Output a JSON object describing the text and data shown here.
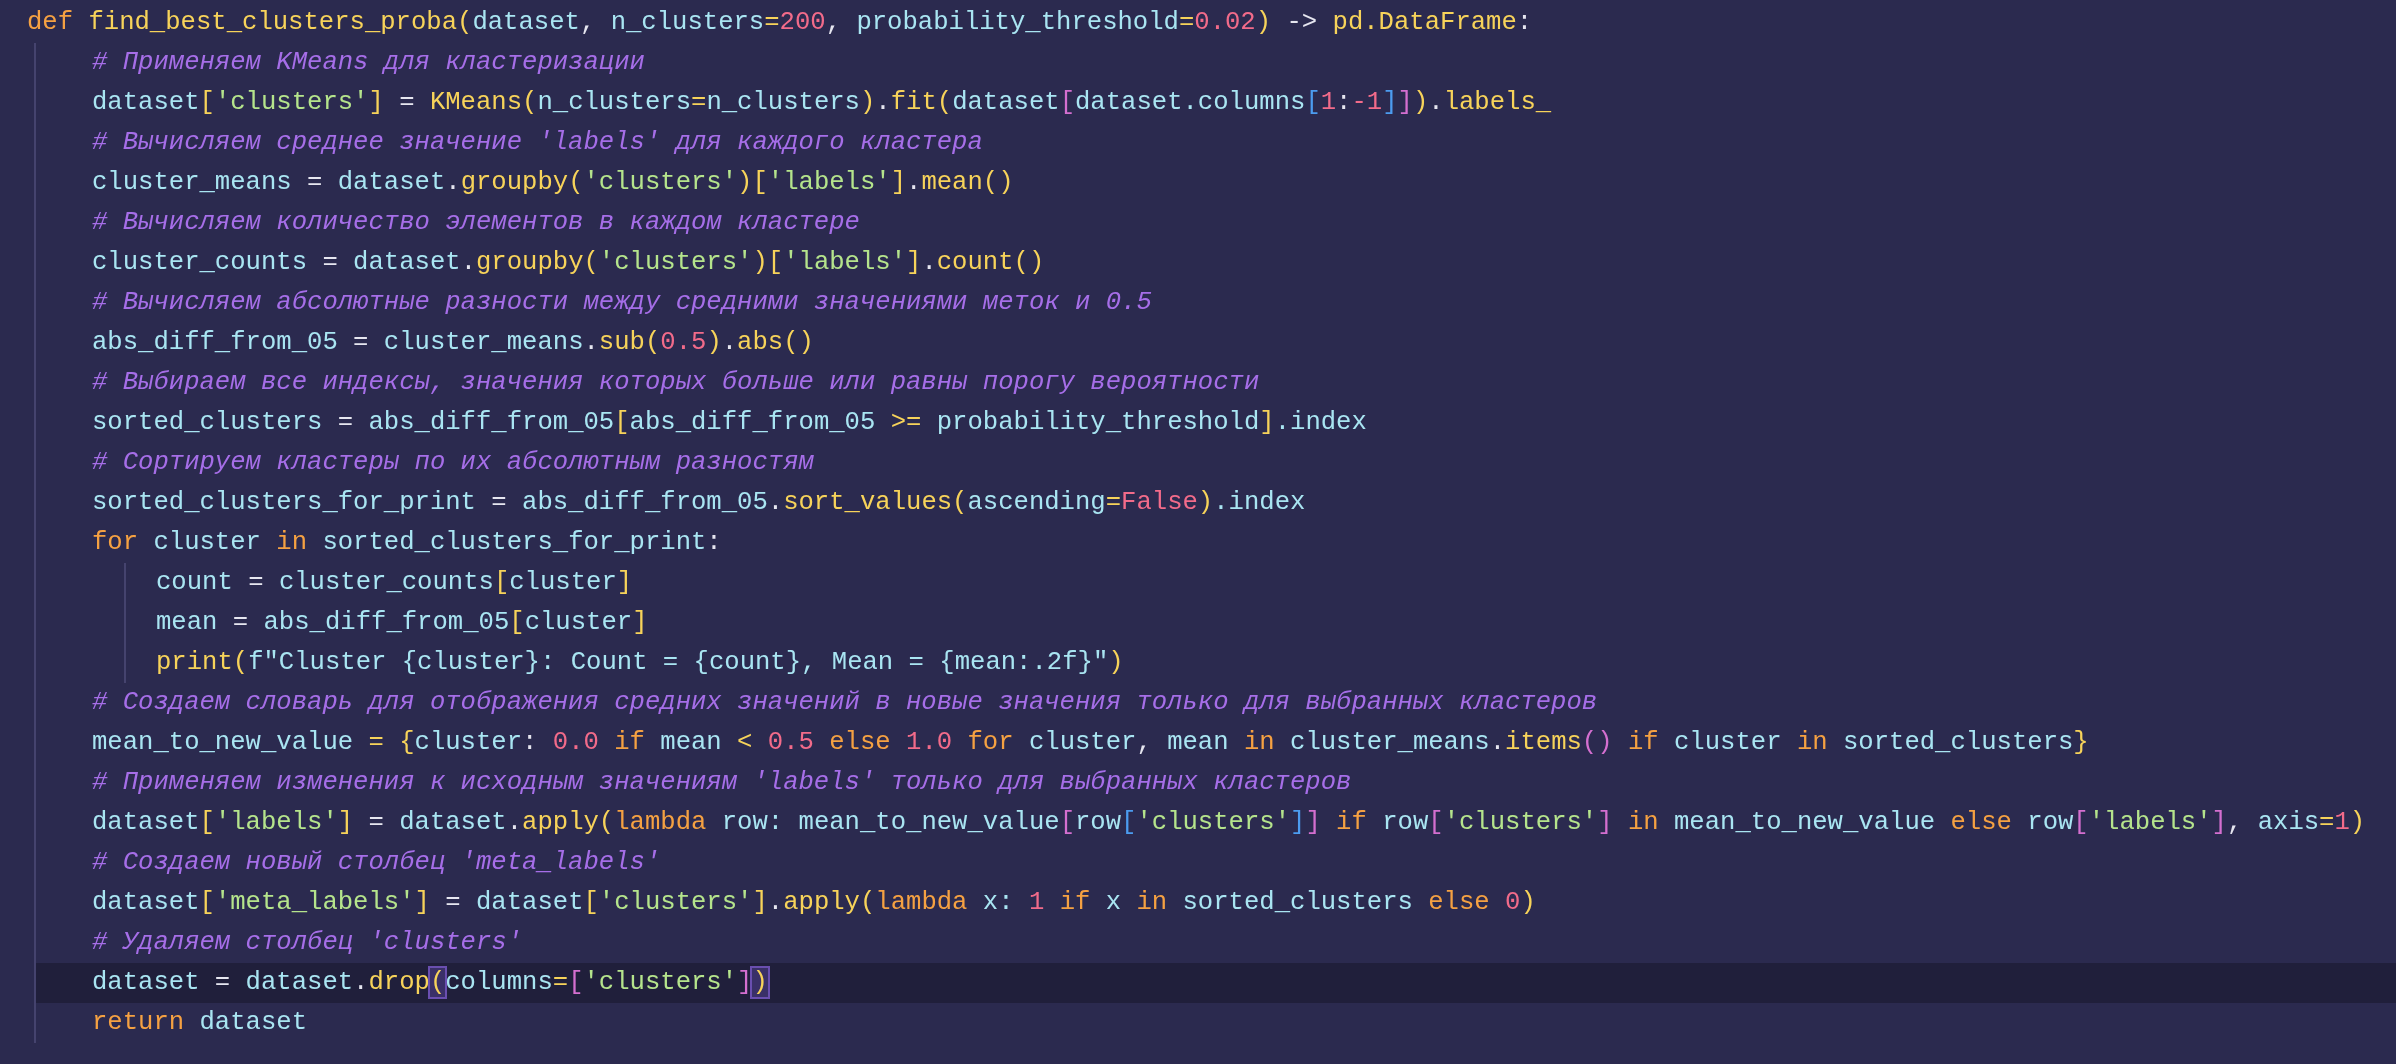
{
  "editor": {
    "lines": [
      {
        "current": false,
        "tokens": [
          {
            "text": "def",
            "kind": "keyword"
          },
          {
            "text": " find_best_clusters_proba",
            "kind": "call"
          },
          {
            "text": "(",
            "kind": "bracket1"
          },
          {
            "text": "dataset",
            "kind": "name"
          },
          {
            "text": ", ",
            "kind": "plain"
          },
          {
            "text": "n_clusters",
            "kind": "name"
          },
          {
            "text": "=",
            "kind": "operator"
          },
          {
            "text": "200",
            "kind": "number"
          },
          {
            "text": ", ",
            "kind": "plain"
          },
          {
            "text": "probability_threshold",
            "kind": "name"
          },
          {
            "text": "=",
            "kind": "operator"
          },
          {
            "text": "0.02",
            "kind": "number"
          },
          {
            "text": ")",
            "kind": "bracket1"
          },
          {
            "text": " -> ",
            "kind": "plain"
          },
          {
            "text": "pd.DataFrame",
            "kind": "call"
          },
          {
            "text": ":",
            "kind": "plain"
          }
        ],
        "children": [
          {
            "current": false,
            "tokens": [
              {
                "text": "# Применяем KMeans для кластеризации",
                "kind": "comment"
              }
            ]
          },
          {
            "current": false,
            "tokens": [
              {
                "text": "dataset",
                "kind": "name"
              },
              {
                "text": "[",
                "kind": "bracket1"
              },
              {
                "text": "'clusters'",
                "kind": "string"
              },
              {
                "text": "]",
                "kind": "bracket1"
              },
              {
                "text": " = ",
                "kind": "plain"
              },
              {
                "text": "KMeans",
                "kind": "call"
              },
              {
                "text": "(",
                "kind": "bracket1"
              },
              {
                "text": "n_clusters",
                "kind": "name"
              },
              {
                "text": "=",
                "kind": "operator"
              },
              {
                "text": "n_clusters",
                "kind": "name"
              },
              {
                "text": ")",
                "kind": "bracket1"
              },
              {
                "text": ".",
                "kind": "plain"
              },
              {
                "text": "fit",
                "kind": "call"
              },
              {
                "text": "(",
                "kind": "bracket1"
              },
              {
                "text": "dataset",
                "kind": "name"
              },
              {
                "text": "[",
                "kind": "bracket2"
              },
              {
                "text": "dataset.columns",
                "kind": "name"
              },
              {
                "text": "[",
                "kind": "bracket3"
              },
              {
                "text": "1",
                "kind": "number"
              },
              {
                "text": ":",
                "kind": "plain"
              },
              {
                "text": "-1",
                "kind": "number"
              },
              {
                "text": "]",
                "kind": "bracket3"
              },
              {
                "text": "]",
                "kind": "bracket2"
              },
              {
                "text": ")",
                "kind": "bracket1"
              },
              {
                "text": ".",
                "kind": "plain"
              },
              {
                "text": "labels_",
                "kind": "call"
              }
            ]
          },
          {
            "current": false,
            "tokens": [
              {
                "text": "# Вычисляем среднее значение 'labels' для каждого кластера",
                "kind": "comment"
              }
            ]
          },
          {
            "current": false,
            "tokens": [
              {
                "text": "cluster_means",
                "kind": "name"
              },
              {
                "text": " = ",
                "kind": "plain"
              },
              {
                "text": "dataset",
                "kind": "name"
              },
              {
                "text": ".",
                "kind": "plain"
              },
              {
                "text": "groupby",
                "kind": "call"
              },
              {
                "text": "(",
                "kind": "bracket1"
              },
              {
                "text": "'clusters'",
                "kind": "string"
              },
              {
                "text": ")",
                "kind": "bracket1"
              },
              {
                "text": "[",
                "kind": "bracket1"
              },
              {
                "text": "'labels'",
                "kind": "string"
              },
              {
                "text": "]",
                "kind": "bracket1"
              },
              {
                "text": ".",
                "kind": "plain"
              },
              {
                "text": "mean",
                "kind": "call"
              },
              {
                "text": "()",
                "kind": "bracket1"
              }
            ]
          },
          {
            "current": false,
            "tokens": [
              {
                "text": "# Вычисляем количество элементов в каждом кластере",
                "kind": "comment"
              }
            ]
          },
          {
            "current": false,
            "tokens": [
              {
                "text": "cluster_counts",
                "kind": "name"
              },
              {
                "text": " = ",
                "kind": "plain"
              },
              {
                "text": "dataset",
                "kind": "name"
              },
              {
                "text": ".",
                "kind": "plain"
              },
              {
                "text": "groupby",
                "kind": "call"
              },
              {
                "text": "(",
                "kind": "bracket1"
              },
              {
                "text": "'clusters'",
                "kind": "string"
              },
              {
                "text": ")",
                "kind": "bracket1"
              },
              {
                "text": "[",
                "kind": "bracket1"
              },
              {
                "text": "'labels'",
                "kind": "string"
              },
              {
                "text": "]",
                "kind": "bracket1"
              },
              {
                "text": ".",
                "kind": "plain"
              },
              {
                "text": "count",
                "kind": "call"
              },
              {
                "text": "()",
                "kind": "bracket1"
              }
            ]
          },
          {
            "current": false,
            "tokens": [
              {
                "text": "# Вычисляем абсолютные разности между средними значениями меток и 0.5",
                "kind": "comment"
              }
            ]
          },
          {
            "current": false,
            "tokens": [
              {
                "text": "abs_diff_from_05",
                "kind": "name"
              },
              {
                "text": " = ",
                "kind": "plain"
              },
              {
                "text": "cluster_means",
                "kind": "name"
              },
              {
                "text": ".",
                "kind": "plain"
              },
              {
                "text": "sub",
                "kind": "call"
              },
              {
                "text": "(",
                "kind": "bracket1"
              },
              {
                "text": "0.5",
                "kind": "number"
              },
              {
                "text": ")",
                "kind": "bracket1"
              },
              {
                "text": ".",
                "kind": "plain"
              },
              {
                "text": "abs",
                "kind": "call"
              },
              {
                "text": "()",
                "kind": "bracket1"
              }
            ]
          },
          {
            "current": false,
            "tokens": [
              {
                "text": "# Выбираем все индексы, значения которых больше или равны порогу вероятности",
                "kind": "comment"
              }
            ]
          },
          {
            "current": false,
            "tokens": [
              {
                "text": "sorted_clusters",
                "kind": "name"
              },
              {
                "text": " = ",
                "kind": "plain"
              },
              {
                "text": "abs_diff_from_05",
                "kind": "name"
              },
              {
                "text": "[",
                "kind": "bracket1"
              },
              {
                "text": "abs_diff_from_05",
                "kind": "name"
              },
              {
                "text": " >= ",
                "kind": "operator"
              },
              {
                "text": "probability_threshold",
                "kind": "name"
              },
              {
                "text": "]",
                "kind": "bracket1"
              },
              {
                "text": ".index",
                "kind": "name"
              }
            ]
          },
          {
            "current": false,
            "tokens": [
              {
                "text": "# Сортируем кластеры по их абсолютным разностям",
                "kind": "comment"
              }
            ]
          },
          {
            "current": false,
            "tokens": [
              {
                "text": "sorted_clusters_for_print",
                "kind": "name"
              },
              {
                "text": " = ",
                "kind": "plain"
              },
              {
                "text": "abs_diff_from_05",
                "kind": "name"
              },
              {
                "text": ".",
                "kind": "plain"
              },
              {
                "text": "sort_values",
                "kind": "call"
              },
              {
                "text": "(",
                "kind": "bracket1"
              },
              {
                "text": "ascending",
                "kind": "name"
              },
              {
                "text": "=",
                "kind": "operator"
              },
              {
                "text": "False",
                "kind": "number"
              },
              {
                "text": ")",
                "kind": "bracket1"
              },
              {
                "text": ".index",
                "kind": "name"
              }
            ]
          },
          {
            "current": false,
            "tokens": [
              {
                "text": "for",
                "kind": "keyword"
              },
              {
                "text": " cluster ",
                "kind": "name"
              },
              {
                "text": "in",
                "kind": "keyword"
              },
              {
                "text": " sorted_clusters_for_print",
                "kind": "name"
              },
              {
                "text": ":",
                "kind": "plain"
              }
            ],
            "children": [
              {
                "current": false,
                "tokens": [
                  {
                    "text": "count",
                    "kind": "name"
                  },
                  {
                    "text": " = ",
                    "kind": "plain"
                  },
                  {
                    "text": "cluster_counts",
                    "kind": "name"
                  },
                  {
                    "text": "[",
                    "kind": "bracket1"
                  },
                  {
                    "text": "cluster",
                    "kind": "name"
                  },
                  {
                    "text": "]",
                    "kind": "bracket1"
                  }
                ]
              },
              {
                "current": false,
                "tokens": [
                  {
                    "text": "mean",
                    "kind": "name"
                  },
                  {
                    "text": " = ",
                    "kind": "plain"
                  },
                  {
                    "text": "abs_diff_from_05",
                    "kind": "name"
                  },
                  {
                    "text": "[",
                    "kind": "bracket1"
                  },
                  {
                    "text": "cluster",
                    "kind": "name"
                  },
                  {
                    "text": "]",
                    "kind": "bracket1"
                  }
                ]
              },
              {
                "current": false,
                "tokens": [
                  {
                    "text": "print",
                    "kind": "call"
                  },
                  {
                    "text": "(",
                    "kind": "bracket1"
                  },
                  {
                    "text": "f\"Cluster {cluster}: Count = {count}, Mean = {mean:.2f}\"",
                    "kind": "fstring"
                  },
                  {
                    "text": ")",
                    "kind": "bracket1"
                  }
                ]
              }
            ]
          },
          {
            "current": false,
            "tokens": [
              {
                "text": "# Создаем словарь для отображения средних значений в новые значения только для выбранных кластеров",
                "kind": "comment"
              }
            ]
          },
          {
            "current": false,
            "tokens": [
              {
                "text": "mean_to_new_value",
                "kind": "name"
              },
              {
                "text": " = ",
                "kind": "operator"
              },
              {
                "text": "{",
                "kind": "bracket1"
              },
              {
                "text": "cluster",
                "kind": "name"
              },
              {
                "text": ": ",
                "kind": "plain"
              },
              {
                "text": "0.0",
                "kind": "number"
              },
              {
                "text": " if ",
                "kind": "keyword"
              },
              {
                "text": "mean",
                "kind": "name"
              },
              {
                "text": " < ",
                "kind": "operator"
              },
              {
                "text": "0.5",
                "kind": "number"
              },
              {
                "text": " else ",
                "kind": "keyword"
              },
              {
                "text": "1.0",
                "kind": "number"
              },
              {
                "text": " for ",
                "kind": "keyword"
              },
              {
                "text": "cluster",
                "kind": "name"
              },
              {
                "text": ", ",
                "kind": "plain"
              },
              {
                "text": "mean",
                "kind": "name"
              },
              {
                "text": " in ",
                "kind": "keyword"
              },
              {
                "text": "cluster_means",
                "kind": "name"
              },
              {
                "text": ".",
                "kind": "plain"
              },
              {
                "text": "items",
                "kind": "call"
              },
              {
                "text": "()",
                "kind": "bracket2"
              },
              {
                "text": " if ",
                "kind": "keyword"
              },
              {
                "text": "cluster",
                "kind": "name"
              },
              {
                "text": " in ",
                "kind": "keyword"
              },
              {
                "text": "sorted_clusters",
                "kind": "name"
              },
              {
                "text": "}",
                "kind": "bracket1"
              }
            ]
          },
          {
            "current": false,
            "tokens": [
              {
                "text": "# Применяем изменения к исходным значениям 'labels' только для выбранных кластеров",
                "kind": "comment"
              }
            ]
          },
          {
            "current": false,
            "tokens": [
              {
                "text": "dataset",
                "kind": "name"
              },
              {
                "text": "[",
                "kind": "bracket1"
              },
              {
                "text": "'labels'",
                "kind": "string"
              },
              {
                "text": "]",
                "kind": "bracket1"
              },
              {
                "text": " = ",
                "kind": "plain"
              },
              {
                "text": "dataset",
                "kind": "name"
              },
              {
                "text": ".",
                "kind": "plain"
              },
              {
                "text": "apply",
                "kind": "call"
              },
              {
                "text": "(",
                "kind": "bracket1"
              },
              {
                "text": "lambda",
                "kind": "keyword"
              },
              {
                "text": " row: mean_to_new_value",
                "kind": "name"
              },
              {
                "text": "[",
                "kind": "bracket2"
              },
              {
                "text": "row",
                "kind": "name"
              },
              {
                "text": "[",
                "kind": "bracket3"
              },
              {
                "text": "'clusters'",
                "kind": "string"
              },
              {
                "text": "]",
                "kind": "bracket3"
              },
              {
                "text": "]",
                "kind": "bracket2"
              },
              {
                "text": " if ",
                "kind": "keyword"
              },
              {
                "text": "row",
                "kind": "name"
              },
              {
                "text": "[",
                "kind": "bracket2"
              },
              {
                "text": "'clusters'",
                "kind": "string"
              },
              {
                "text": "]",
                "kind": "bracket2"
              },
              {
                "text": " in ",
                "kind": "keyword"
              },
              {
                "text": "mean_to_new_value",
                "kind": "name"
              },
              {
                "text": " else ",
                "kind": "keyword"
              },
              {
                "text": "row",
                "kind": "name"
              },
              {
                "text": "[",
                "kind": "bracket2"
              },
              {
                "text": "'labels'",
                "kind": "string"
              },
              {
                "text": "]",
                "kind": "bracket2"
              },
              {
                "text": ", ",
                "kind": "plain"
              },
              {
                "text": "axis",
                "kind": "name"
              },
              {
                "text": "=",
                "kind": "operator"
              },
              {
                "text": "1",
                "kind": "number"
              },
              {
                "text": ")",
                "kind": "bracket1"
              }
            ]
          },
          {
            "current": false,
            "tokens": [
              {
                "text": "# Создаем новый столбец 'meta_labels'",
                "kind": "comment"
              }
            ]
          },
          {
            "current": false,
            "tokens": [
              {
                "text": "dataset",
                "kind": "name"
              },
              {
                "text": "[",
                "kind": "bracket1"
              },
              {
                "text": "'meta_labels'",
                "kind": "string"
              },
              {
                "text": "]",
                "kind": "bracket1"
              },
              {
                "text": " = ",
                "kind": "plain"
              },
              {
                "text": "dataset",
                "kind": "name"
              },
              {
                "text": "[",
                "kind": "bracket1"
              },
              {
                "text": "'clusters'",
                "kind": "string"
              },
              {
                "text": "]",
                "kind": "bracket1"
              },
              {
                "text": ".",
                "kind": "plain"
              },
              {
                "text": "apply",
                "kind": "call"
              },
              {
                "text": "(",
                "kind": "bracket1"
              },
              {
                "text": "lambda",
                "kind": "keyword"
              },
              {
                "text": " x: ",
                "kind": "name"
              },
              {
                "text": "1",
                "kind": "number"
              },
              {
                "text": " if ",
                "kind": "keyword"
              },
              {
                "text": "x",
                "kind": "name"
              },
              {
                "text": " in ",
                "kind": "keyword"
              },
              {
                "text": "sorted_clusters",
                "kind": "name"
              },
              {
                "text": " else ",
                "kind": "keyword"
              },
              {
                "text": "0",
                "kind": "number"
              },
              {
                "text": ")",
                "kind": "bracket1"
              }
            ]
          },
          {
            "current": false,
            "tokens": [
              {
                "text": "# Удаляем столбец 'clusters'",
                "kind": "comment"
              }
            ]
          },
          {
            "current": true,
            "tokens": [
              {
                "text": "dataset",
                "kind": "name"
              },
              {
                "text": " = ",
                "kind": "plain"
              },
              {
                "text": "dataset",
                "kind": "name"
              },
              {
                "text": ".",
                "kind": "plain"
              },
              {
                "text": "drop",
                "kind": "call"
              },
              {
                "text": "(",
                "kind": "matchedbracket"
              },
              {
                "text": "columns",
                "kind": "name"
              },
              {
                "text": "=",
                "kind": "operator"
              },
              {
                "text": "[",
                "kind": "bracket2"
              },
              {
                "text": "'clusters'",
                "kind": "string"
              },
              {
                "text": "]",
                "kind": "bracket2"
              },
              {
                "text": ")",
                "kind": "matchedbracket"
              }
            ]
          },
          {
            "current": false,
            "tokens": [
              {
                "text": "return",
                "kind": "keyword"
              },
              {
                "text": " dataset",
                "kind": "name"
              }
            ]
          }
        ]
      }
    ]
  }
}
